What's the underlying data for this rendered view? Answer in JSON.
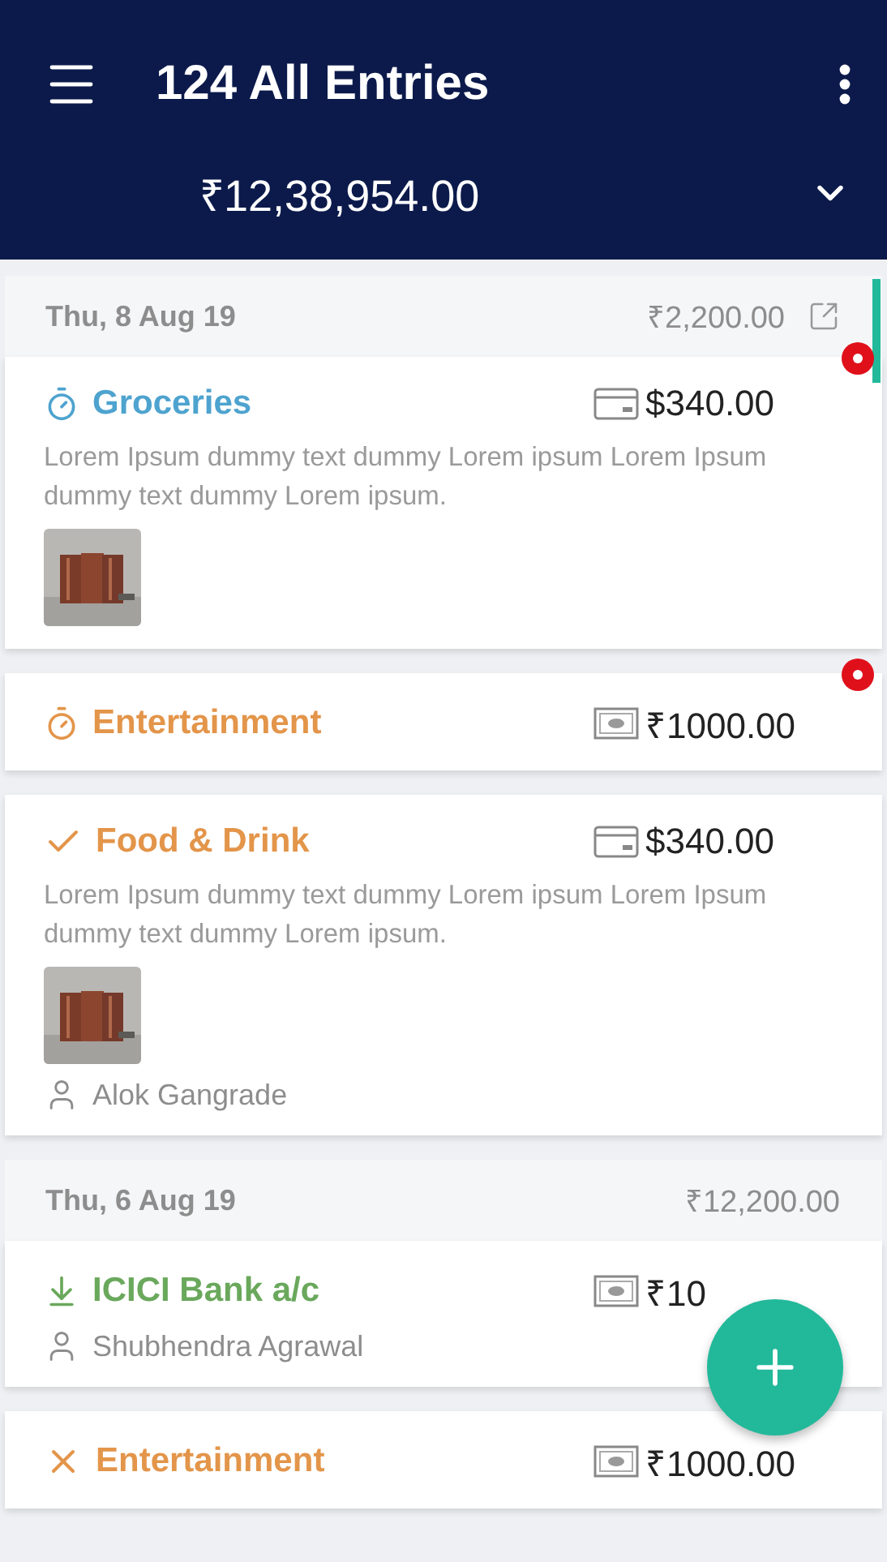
{
  "header": {
    "title": "124 All Entries",
    "total": "₹12,38,954.00"
  },
  "groups": [
    {
      "date": "Thu, 8 Aug 19",
      "total": "₹2,200.00",
      "export_link": true,
      "entries": [
        {
          "kind": "pending",
          "color": "#4ea3cf",
          "title": "Groceries",
          "payment": {
            "kind": "card"
          },
          "amount": "$340.00",
          "description": "Lorem Ipsum dummy text dummy Lorem ipsum Lorem Ipsum dummy text dummy Lorem ipsum.",
          "flagged": true
        },
        {
          "kind": "pending",
          "color": "#e3954a",
          "title": "Entertainment",
          "payment": {
            "kind": "cash"
          },
          "amount": "₹1000.00",
          "flagged": true
        },
        {
          "kind": "done",
          "color": "#e3954a",
          "title": "Food & Drink",
          "payment": {
            "kind": "card"
          },
          "amount": "$340.00",
          "description": "Lorem Ipsum dummy text dummy Lorem ipsum Lorem Ipsum dummy text dummy Lorem ipsum.",
          "person": "Alok Gangrade",
          "flagged": false
        }
      ]
    },
    {
      "date": "Thu, 6 Aug 19",
      "total": "₹12,200.00",
      "export_link": false,
      "entries": [
        {
          "kind": "received",
          "color": "#6aa85c",
          "title": "ICICI Bank a/c",
          "payment": {
            "kind": "cash"
          },
          "amount": "₹10",
          "person": "Shubhendra Agrawal",
          "flagged": false
        },
        {
          "kind": "rejected",
          "color": "#e3954a",
          "title": "Entertainment",
          "payment": {
            "kind": "cash"
          },
          "amount": "₹1000.00",
          "flagged": false
        }
      ]
    }
  ]
}
